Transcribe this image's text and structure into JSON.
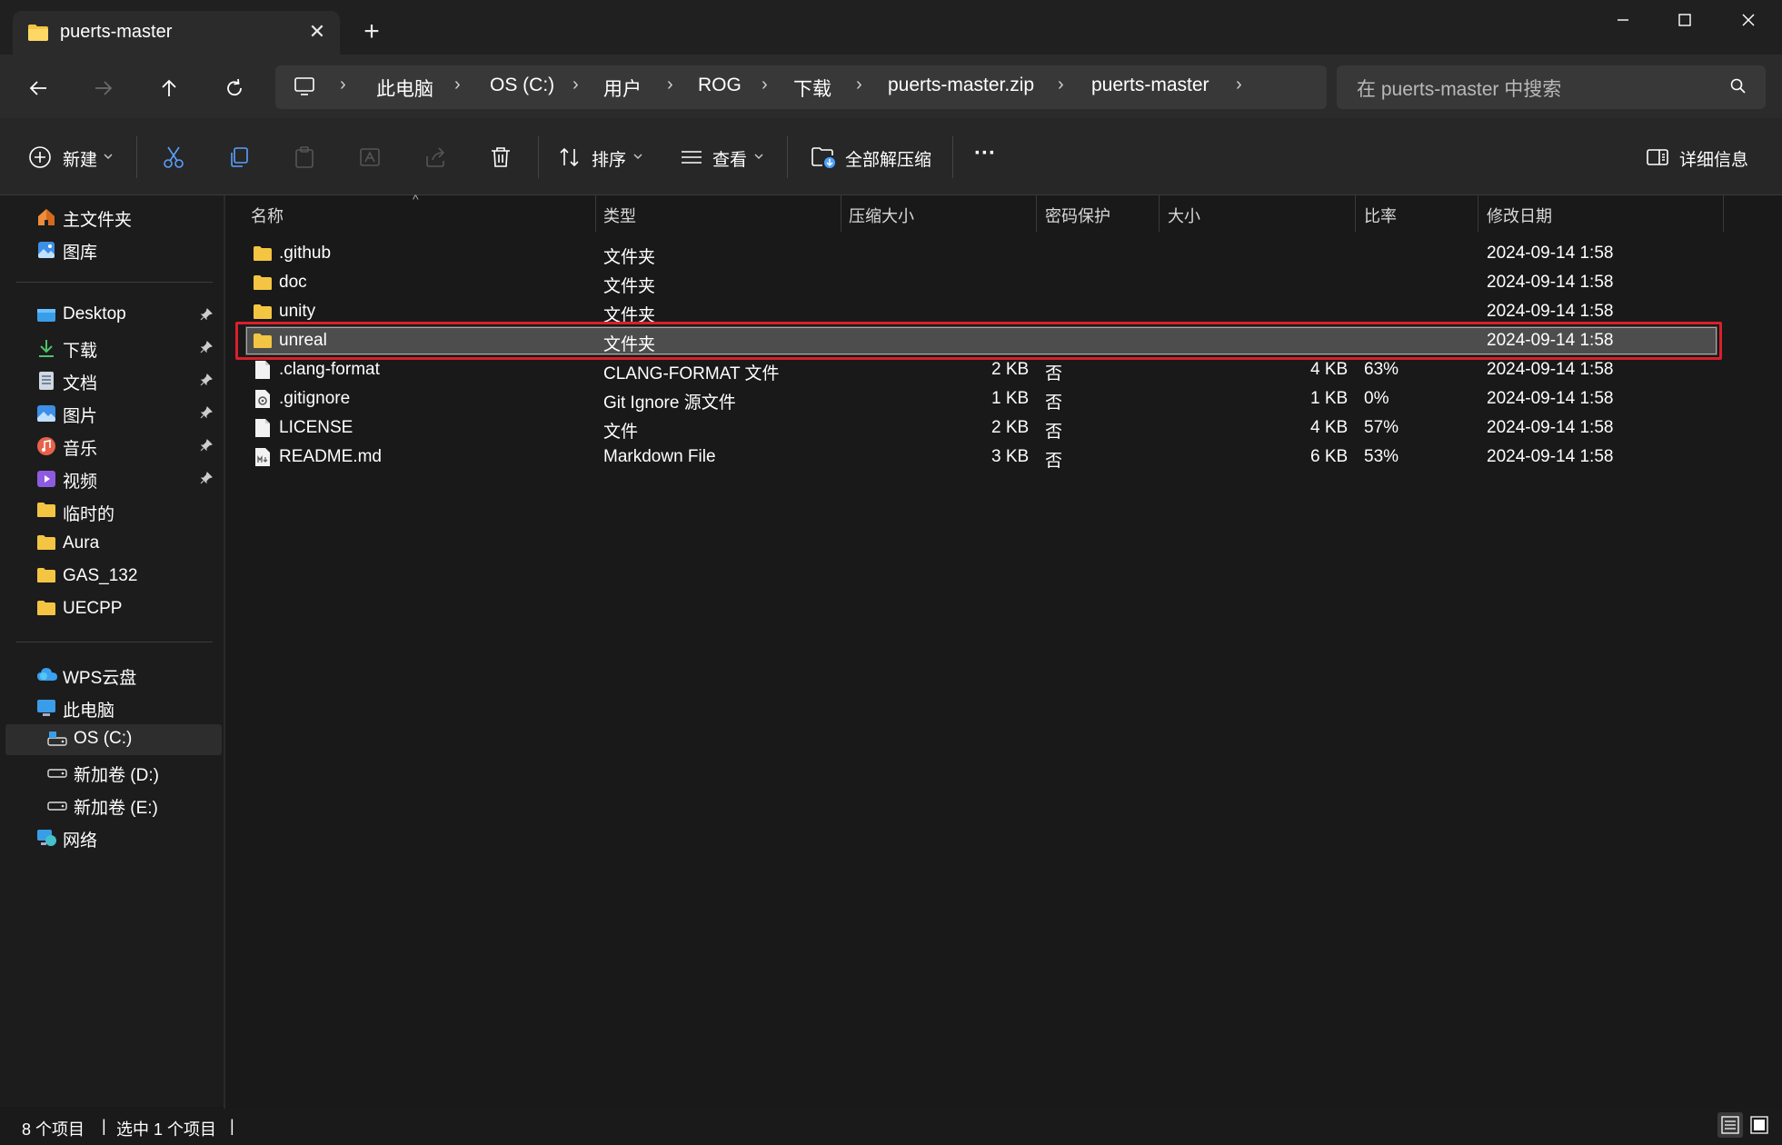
{
  "window": {
    "tab_title": "puerts-master",
    "close_tab": "✕",
    "new_tab": "+",
    "minimize": "—",
    "maximize": "☐",
    "close": "✕"
  },
  "breadcrumbs": [
    "此电脑",
    "OS (C:)",
    "用户",
    "ROG",
    "下载",
    "puerts-master.zip",
    "puerts-master"
  ],
  "search": {
    "placeholder": "在 puerts-master 中搜索"
  },
  "toolbar": {
    "new": "新建",
    "sort": "排序",
    "view": "查看",
    "extract_all": "全部解压缩",
    "more": "···",
    "details": "详细信息"
  },
  "sidebar": {
    "quick": [
      {
        "label": "主文件夹",
        "icon": "home-icon"
      },
      {
        "label": "图库",
        "icon": "gallery-icon"
      }
    ],
    "pinned": [
      {
        "label": "Desktop",
        "icon": "desktop-icon",
        "pinned": true
      },
      {
        "label": "下载",
        "icon": "download-icon",
        "pinned": true
      },
      {
        "label": "文档",
        "icon": "document-icon",
        "pinned": true
      },
      {
        "label": "图片",
        "icon": "picture-icon",
        "pinned": true
      },
      {
        "label": "音乐",
        "icon": "music-icon",
        "pinned": true
      },
      {
        "label": "视频",
        "icon": "video-icon",
        "pinned": true
      },
      {
        "label": "临时的",
        "icon": "folder-icon",
        "pinned": false
      },
      {
        "label": "Aura",
        "icon": "folder-icon",
        "pinned": false
      },
      {
        "label": "GAS_132",
        "icon": "folder-icon",
        "pinned": false
      },
      {
        "label": "UECPP",
        "icon": "folder-icon",
        "pinned": false
      }
    ],
    "locations": [
      {
        "label": "WPS云盘",
        "icon": "cloud-icon"
      },
      {
        "label": "此电脑",
        "icon": "computer-icon"
      },
      {
        "label": "OS (C:)",
        "icon": "drive-icon",
        "selected": true
      },
      {
        "label": "新加卷 (D:)",
        "icon": "drive-icon"
      },
      {
        "label": "新加卷 (E:)",
        "icon": "drive-icon"
      },
      {
        "label": "网络",
        "icon": "network-icon"
      }
    ]
  },
  "columns": [
    "名称",
    "类型",
    "压缩大小",
    "密码保护",
    "大小",
    "比率",
    "修改日期"
  ],
  "files": [
    {
      "name": ".github",
      "type": "文件夹",
      "compressed": "",
      "password": "",
      "size": "",
      "ratio": "",
      "date": "2024-09-14 1:58",
      "icon": "folder-icon"
    },
    {
      "name": "doc",
      "type": "文件夹",
      "compressed": "",
      "password": "",
      "size": "",
      "ratio": "",
      "date": "2024-09-14 1:58",
      "icon": "folder-icon"
    },
    {
      "name": "unity",
      "type": "文件夹",
      "compressed": "",
      "password": "",
      "size": "",
      "ratio": "",
      "date": "2024-09-14 1:58",
      "icon": "folder-icon"
    },
    {
      "name": "unreal",
      "type": "文件夹",
      "compressed": "",
      "password": "",
      "size": "",
      "ratio": "",
      "date": "2024-09-14 1:58",
      "icon": "folder-icon",
      "selected": true
    },
    {
      "name": ".clang-format",
      "type": "CLANG-FORMAT 文件",
      "compressed": "2 KB",
      "password": "否",
      "size": "4 KB",
      "ratio": "63%",
      "date": "2024-09-14 1:58",
      "icon": "file-icon"
    },
    {
      "name": ".gitignore",
      "type": "Git Ignore 源文件",
      "compressed": "1 KB",
      "password": "否",
      "size": "1 KB",
      "ratio": "0%",
      "date": "2024-09-14 1:58",
      "icon": "gear-file-icon"
    },
    {
      "name": "LICENSE",
      "type": "文件",
      "compressed": "2 KB",
      "password": "否",
      "size": "4 KB",
      "ratio": "57%",
      "date": "2024-09-14 1:58",
      "icon": "file-icon"
    },
    {
      "name": "README.md",
      "type": "Markdown File",
      "compressed": "3 KB",
      "password": "否",
      "size": "6 KB",
      "ratio": "53%",
      "date": "2024-09-14 1:58",
      "icon": "markdown-file-icon"
    }
  ],
  "status": {
    "item_count": "8 个项目",
    "selected_count": "选中 1 个项目",
    "divider": "|"
  },
  "colors": {
    "background": "#191919",
    "chrome": "#2b2b2b",
    "selection": "#4d4d4d",
    "highlight": "#d9202b",
    "folder": "#f4c542"
  }
}
